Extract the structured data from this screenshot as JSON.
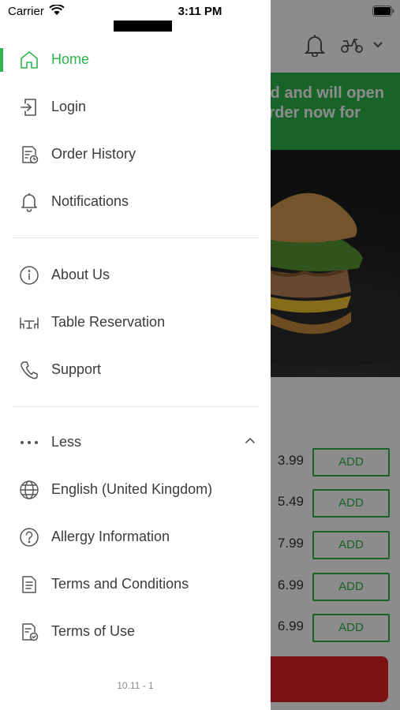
{
  "status_bar": {
    "carrier": "Carrier",
    "time": "3:11 PM"
  },
  "background_app": {
    "banner_lines": [
      "ed and will open",
      "rder now for"
    ],
    "prices": [
      "3.99",
      "5.49",
      "7.99",
      "6.99",
      "6.99"
    ],
    "add_label": "ADD",
    "accent_color": "#2fb34a",
    "checkout_color": "#e02020"
  },
  "drawer": {
    "section_main": [
      {
        "label": "Home",
        "icon": "home-icon",
        "active": true
      },
      {
        "label": "Login",
        "icon": "login-icon"
      },
      {
        "label": "Order History",
        "icon": "order-history-icon"
      },
      {
        "label": "Notifications",
        "icon": "bell-icon"
      }
    ],
    "section_info": [
      {
        "label": "About Us",
        "icon": "info-icon"
      },
      {
        "label": "Table Reservation",
        "icon": "table-icon"
      },
      {
        "label": "Support",
        "icon": "phone-icon"
      }
    ],
    "less_label": "Less",
    "section_more": [
      {
        "label": "English (United Kingdom)",
        "icon": "globe-icon"
      },
      {
        "label": "Allergy Information",
        "icon": "question-icon"
      },
      {
        "label": "Terms and Conditions",
        "icon": "document-icon"
      },
      {
        "label": "Terms of Use",
        "icon": "document-check-icon"
      }
    ],
    "version": "10.11 - 1"
  }
}
